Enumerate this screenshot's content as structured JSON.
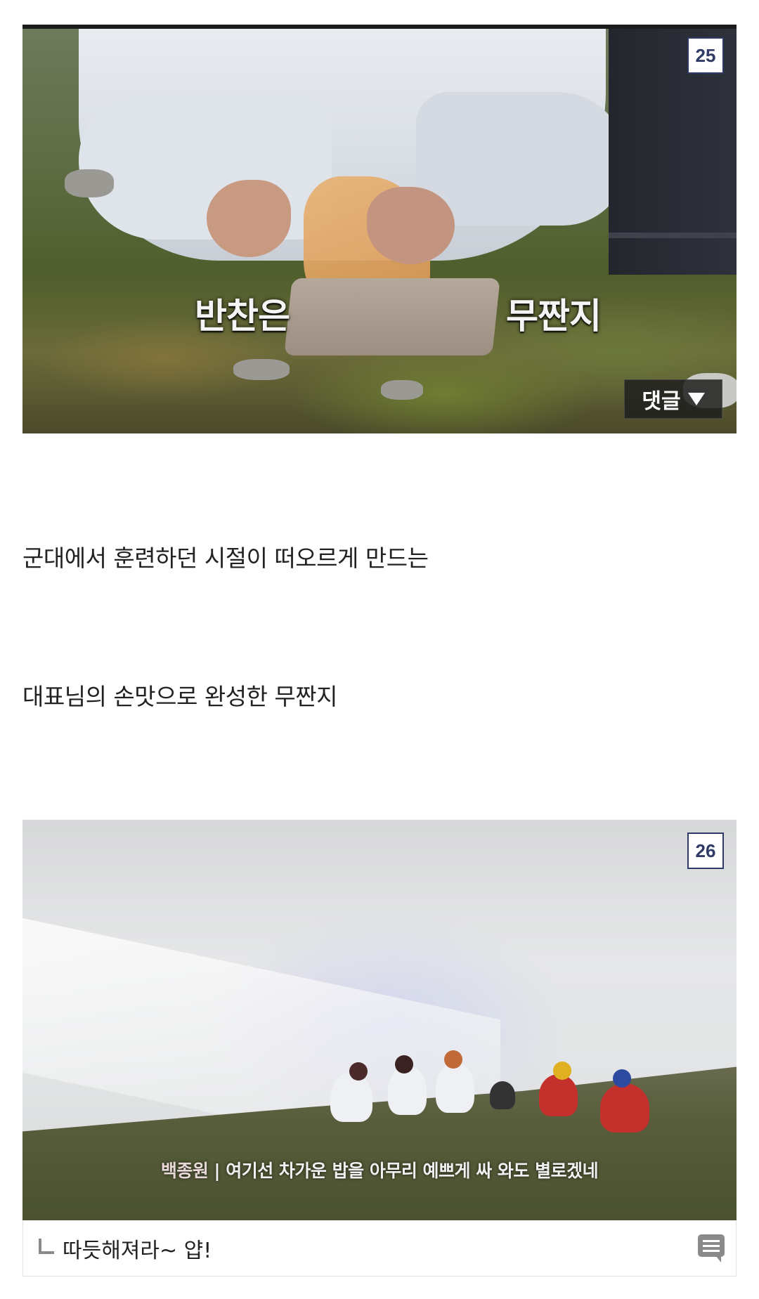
{
  "photo1": {
    "badge": "25",
    "subtitle_left": "반찬은",
    "subtitle_right": "무짠지",
    "comment_button": "댓글"
  },
  "paragraphs": [
    "군대에서 훈련하던 시절이 떠오르게 만드는",
    "대표님의 손맛으로 완성한 무짠지"
  ],
  "photo2": {
    "badge": "26",
    "subtitle_speaker": "백종원",
    "subtitle_text": "| 여기선 차가운 밥을 아무리 예쁘게 싸 와도 별로겠네"
  },
  "caption": {
    "text": "따듯해져라~ 얍!"
  },
  "icons": [
    "corner-arrow-icon",
    "chat-icon",
    "triangle-down-icon"
  ]
}
